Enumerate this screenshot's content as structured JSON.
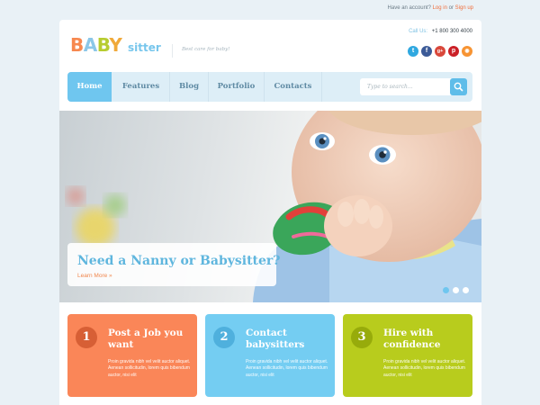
{
  "topbar": {
    "prefix": "Have an account?",
    "login": "Log in",
    "or": "or",
    "signup": "Sign up"
  },
  "header": {
    "logo_baby": [
      "B",
      "A",
      "B",
      "Y"
    ],
    "logo_sitter": "sitter",
    "tagline": "Best care for baby!",
    "call_label": "Call Us:",
    "phone": "+1 800 300 4000"
  },
  "social": [
    {
      "name": "twitter",
      "glyph": "t",
      "color": "#2fa8e0"
    },
    {
      "name": "facebook",
      "glyph": "f",
      "color": "#3b5a97"
    },
    {
      "name": "google-plus",
      "glyph": "g+",
      "color": "#d9483b"
    },
    {
      "name": "pinterest",
      "glyph": "p",
      "color": "#cb2027"
    },
    {
      "name": "rss",
      "glyph": "◉",
      "color": "#f79433"
    }
  ],
  "nav": {
    "home": "Home",
    "features": "Features",
    "blog": "Blog",
    "portfolio": "Portfolio",
    "contacts": "Contacts"
  },
  "search": {
    "placeholder": "Type to search..."
  },
  "hero": {
    "title": "Need a Nanny or Babysitter?",
    "link": "Learn More »"
  },
  "features": [
    {
      "number": "1",
      "title": "Post a Job you want",
      "text": "Proin gravida nibh vel velit auctor aliquet. Aenean sollicitudin, lorem quis bibendum auctor, nisi elit",
      "color": "#fa8658",
      "num_color": "#d75f35"
    },
    {
      "number": "2",
      "title": "Contact babysitters",
      "text": "Proin gravida nibh vel velit auctor aliquet. Aenean sollicitudin, lorem quis bibendum auctor, nisi elit",
      "color": "#74cdf2",
      "num_color": "#4fb0dd"
    },
    {
      "number": "3",
      "title": "Hire with confidence",
      "text": "Proin gravida nibh vel velit auctor aliquet. Aenean sollicitudin, lorem quis bibendum auctor, nisi elit",
      "color": "#b8cc1d",
      "num_color": "#97ab0b"
    }
  ]
}
